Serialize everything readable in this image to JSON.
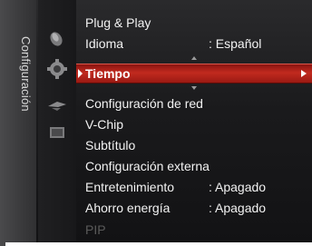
{
  "menu": {
    "category_label": "Configuración",
    "items": [
      {
        "label": "Plug & Play",
        "value": ""
      },
      {
        "label": "Idioma",
        "value": ": Español"
      },
      {
        "label": "Tiempo",
        "value": ""
      },
      {
        "label": "Configuración de red",
        "value": ""
      },
      {
        "label": "V-Chip",
        "value": ""
      },
      {
        "label": "Subtítulo",
        "value": ""
      },
      {
        "label": "Configuración externa",
        "value": ""
      },
      {
        "label": "Entretenimiento",
        "value": ": Apagado"
      },
      {
        "label": "Ahorro energía",
        "value": ": Apagado"
      },
      {
        "label": "PIP",
        "value": ""
      }
    ],
    "selected_index": 2
  },
  "icons": [
    "picture-icon",
    "sound-icon",
    "channel-icon",
    "input-icon"
  ],
  "colors": {
    "selection": "#c12a1f",
    "text": "#f2f2f2",
    "disabled_text": "#5a5a5a",
    "background": "#1a1a1c"
  }
}
